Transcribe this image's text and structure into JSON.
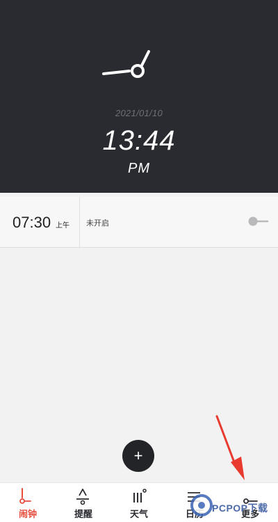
{
  "header": {
    "date": "2021/01/10",
    "time": "13:44",
    "period": "PM"
  },
  "alarms": [
    {
      "time": "07:30",
      "period": "上午",
      "status": "未开启",
      "enabled": false
    }
  ],
  "fab": {
    "label": "+"
  },
  "tabs": [
    {
      "label": "闹钟",
      "icon": "alarm-icon",
      "active": true
    },
    {
      "label": "提醒",
      "icon": "reminder-icon",
      "active": false
    },
    {
      "label": "天气",
      "icon": "weather-icon",
      "active": false
    },
    {
      "label": "日历",
      "icon": "calendar-icon",
      "active": false
    },
    {
      "label": "更多",
      "icon": "more-icon",
      "active": false
    }
  ],
  "watermark": {
    "text": "PCPOP下载"
  },
  "colors": {
    "header_bg": "#2a2b30",
    "accent": "#e74c3c",
    "arrow": "#e83a2e",
    "page_bg": "#f2f2f3"
  }
}
